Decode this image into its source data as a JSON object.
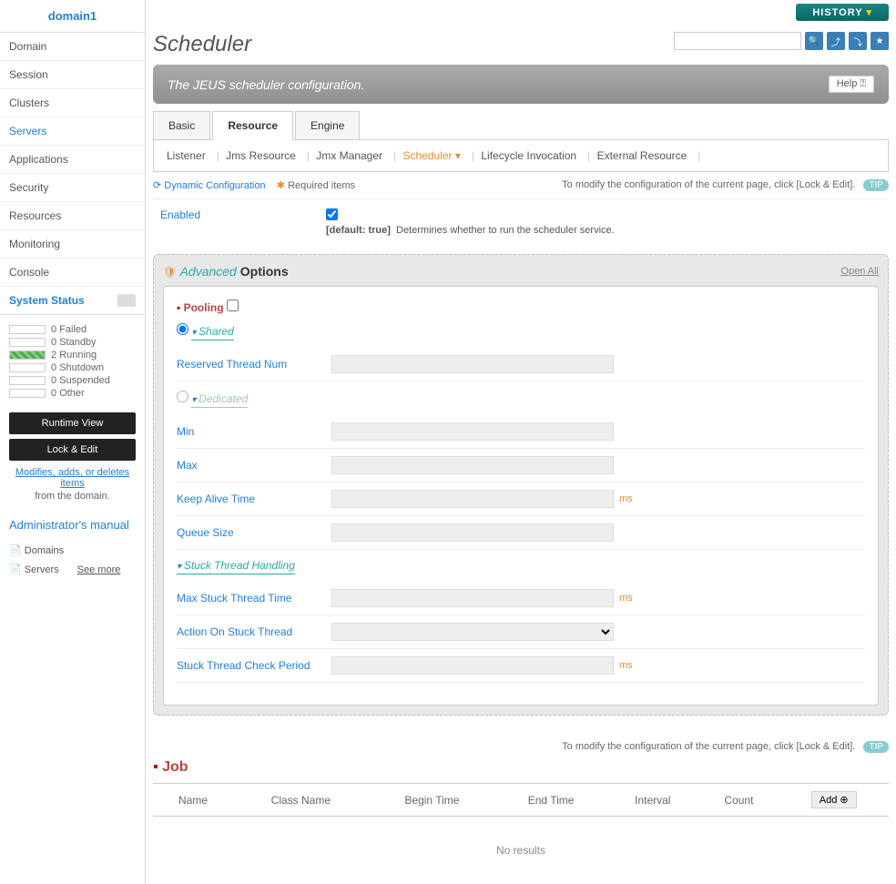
{
  "sidebar": {
    "domain": "domain1",
    "nav": [
      "Domain",
      "Session",
      "Clusters",
      "Servers",
      "Applications",
      "Security",
      "Resources",
      "Monitoring",
      "Console"
    ],
    "active_nav": "Servers",
    "status_title": "System Status",
    "status": [
      {
        "count": "0",
        "label": "Failed"
      },
      {
        "count": "0",
        "label": "Standby"
      },
      {
        "count": "2",
        "label": "Running"
      },
      {
        "count": "0",
        "label": "Shutdown"
      },
      {
        "count": "0",
        "label": "Suspended"
      },
      {
        "count": "0",
        "label": "Other"
      }
    ],
    "runtime_btn": "Runtime View",
    "lock_btn": "Lock & Edit",
    "modify_link": "Modifies, adds, or deletes items",
    "from_text": " from the domain.",
    "manual_title": "Administrator's manual",
    "manual_items": [
      "Domains",
      "Servers"
    ],
    "see_more": "See more"
  },
  "top": {
    "history": "HISTORY"
  },
  "page": {
    "title": "Scheduler",
    "subtitle": "The JEUS scheduler configuration.",
    "help": "Help ⍰"
  },
  "tabs": [
    "Basic",
    "Resource",
    "Engine"
  ],
  "active_tab": "Resource",
  "subtabs": [
    "Listener",
    "Jms Resource",
    "Jmx Manager",
    "Scheduler",
    "Lifecycle Invocation",
    "External Resource"
  ],
  "active_subtab": "Scheduler",
  "config_bar": {
    "dynamic": "Dynamic Configuration",
    "required": "Required items",
    "notice": "To modify the configuration of the current page, click [Lock & Edit].",
    "tip": "TIP"
  },
  "enabled": {
    "label": "Enabled",
    "default": "[default: true]",
    "desc": "Determines whether to run the scheduler service."
  },
  "advanced": {
    "title_adv": "Advanced",
    "title_opt": " Options",
    "open_all": "Open All",
    "pooling": "Pooling",
    "shared": "Shared",
    "dedicated": "Dedicated",
    "stuck": "Stuck Thread Handling",
    "fields": {
      "reserved": "Reserved Thread Num",
      "min": "Min",
      "max": "Max",
      "keep_alive": "Keep Alive Time",
      "queue_size": "Queue Size",
      "max_stuck": "Max Stuck Thread Time",
      "action_stuck": "Action On Stuck Thread",
      "check_period": "Stuck Thread Check Period"
    },
    "unit_ms": "ms"
  },
  "job": {
    "notice": "To modify the configuration of the current page, click [Lock & Edit].",
    "tip": "TIP",
    "title": "Job",
    "columns": [
      "Name",
      "Class Name",
      "Begin Time",
      "End Time",
      "Interval",
      "Count"
    ],
    "add": "Add",
    "empty": "No results"
  }
}
